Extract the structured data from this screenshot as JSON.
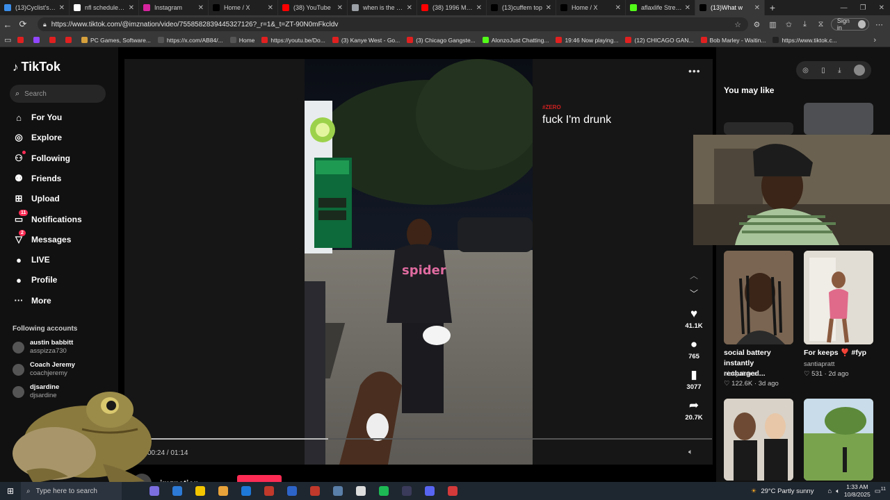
{
  "browser": {
    "tabs": [
      {
        "label": "(13)Cyclist's Fun",
        "fav": "#3b8eea"
      },
      {
        "label": "nfl schedule - Go",
        "fav": "#ffffff"
      },
      {
        "label": "Instagram",
        "fav": "#d6249f"
      },
      {
        "label": "Home / X",
        "fav": "#000000"
      },
      {
        "label": "(38) YouTube",
        "fav": "#ff0000"
      },
      {
        "label": "when is the last",
        "fav": "#9aa0a6"
      },
      {
        "label": "(38) 1996 Micha",
        "fav": "#ff0000"
      },
      {
        "label": "(13)cuffem top",
        "fav": "#000000"
      },
      {
        "label": "Home / X",
        "fav": "#000000"
      },
      {
        "label": "aflaxlife Stream",
        "fav": "#53fc18"
      },
      {
        "label": "(13)What w",
        "fav": "#000000"
      }
    ],
    "new_tab": "+",
    "url": "https://www.tiktok.com/@imznation/video/7558582839445327126?_r=1&_t=ZT-90N0mFkcldv",
    "sign_in": "Sign in",
    "bookmarks": [
      {
        "label": "",
        "color": "#e02020"
      },
      {
        "label": "",
        "color": "#9146ff"
      },
      {
        "label": "",
        "color": "#e02020"
      },
      {
        "label": "",
        "color": "#e02020"
      },
      {
        "label": "PC Games, Software...",
        "color": "#d6a03c"
      },
      {
        "label": "https://x.com/AB84/...",
        "color": "#555555"
      },
      {
        "label": "Home",
        "color": "#555555"
      },
      {
        "label": "https://youtu.be/Do...",
        "color": "#e02020"
      },
      {
        "label": "(3) Kanye West - Go...",
        "color": "#e02020"
      },
      {
        "label": "(3) Chicago Gangste...",
        "color": "#e02020"
      },
      {
        "label": "AlonzoJust Chatting...",
        "color": "#53fc18"
      },
      {
        "label": "19:46 Now playing...",
        "color": "#e02020"
      },
      {
        "label": "(12) CHICAGO GAN...",
        "color": "#e02020"
      },
      {
        "label": "Bob Marley - Waitin...",
        "color": "#e02020"
      },
      {
        "label": "https://www.tiktok.c...",
        "color": "#222222"
      }
    ]
  },
  "tiktok": {
    "logo": "TikTok",
    "search_placeholder": "Search",
    "nav": [
      {
        "label": "For You",
        "icon": "home-icon",
        "glyph": "⌂",
        "badge": ""
      },
      {
        "label": "Explore",
        "icon": "compass-icon",
        "glyph": "◎",
        "badge": ""
      },
      {
        "label": "Following",
        "icon": "following-icon",
        "glyph": "⚇",
        "badge": "dot"
      },
      {
        "label": "Friends",
        "icon": "friends-icon",
        "glyph": "⚉",
        "badge": ""
      },
      {
        "label": "Upload",
        "icon": "upload-icon",
        "glyph": "⊞",
        "badge": ""
      },
      {
        "label": "Notifications",
        "icon": "inbox-icon",
        "glyph": "▭",
        "badge": "11"
      },
      {
        "label": "Messages",
        "icon": "messages-icon",
        "glyph": "▽",
        "badge": "2"
      },
      {
        "label": "LIVE",
        "icon": "live-icon",
        "glyph": "●",
        "badge": ""
      },
      {
        "label": "Profile",
        "icon": "profile-icon",
        "glyph": "●",
        "badge": ""
      },
      {
        "label": "More",
        "icon": "more-icon",
        "glyph": "···",
        "badge": ""
      }
    ],
    "following_header": "Following accounts",
    "accounts": [
      {
        "name": "austin babbitt",
        "handle": "asspizza730"
      },
      {
        "name": "Coach Jeremy",
        "handle": "coachjeremy"
      },
      {
        "name": "djsardine",
        "handle": "djsardine"
      }
    ]
  },
  "player": {
    "overlay_tag": "#ZERO",
    "caption": "fuck I'm drunk",
    "likes": "41.1K",
    "comments": "765",
    "saves": "3077",
    "shares": "20.7K",
    "time": "00:24 / 01:14",
    "progress": 0.32,
    "author": "imznation"
  },
  "sidebar_right": {
    "title": "You may like",
    "cards": [
      {
        "title": "social battery instantly recharged...",
        "author": "nicky.dabrat",
        "likes": "122.6K",
        "age": "3d ago"
      },
      {
        "title": "For keeps ❣️ #fyp",
        "author": "santiapratt",
        "likes": "531",
        "age": "2d ago"
      }
    ]
  },
  "taskbar": {
    "search_placeholder": "Type here to search",
    "weather": "29°C  Partly sunny",
    "time": "1:33 AM",
    "date": "10/8/2025",
    "notif_count": "11",
    "apps": [
      "#7a6ee0",
      "#2c7ad6",
      "#f2c500",
      "#e8a33a",
      "#1e78d7",
      "#c0392b",
      "#2d64c8",
      "#c0392b",
      "#5a7fa8",
      "#dddddd",
      "#1db954",
      "#3a3a5a",
      "#5865f2",
      "#d43a3a"
    ]
  }
}
